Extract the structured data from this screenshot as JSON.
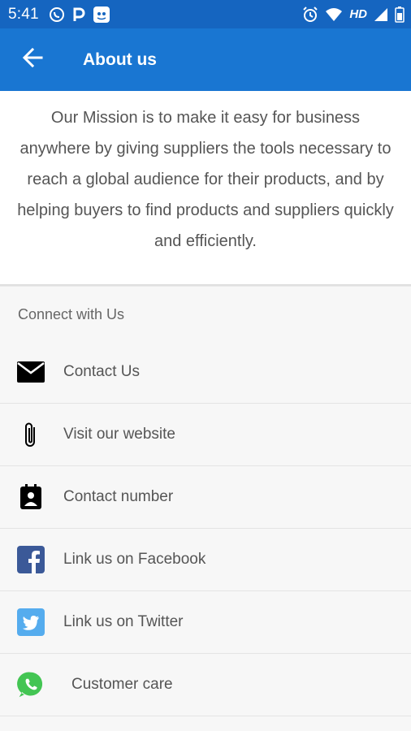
{
  "status_bar": {
    "time": "5:41",
    "left_icons": [
      "whatsapp-icon",
      "p-icon",
      "app-icon"
    ],
    "right_icons": [
      "alarm-icon",
      "wifi-icon",
      "signal-icon",
      "battery-icon"
    ],
    "network": "HD"
  },
  "app_bar": {
    "title": "About us",
    "back_icon": "arrow-back-icon",
    "color": "#1976d2"
  },
  "mission": {
    "text": "Our Mission is to make it easy for business anywhere by giving suppliers the tools necessary to reach a global audience for their products, and by helping buyers to find products and suppliers quickly and efficiently."
  },
  "connect": {
    "header": "Connect with Us",
    "items": [
      {
        "label": "Contact Us",
        "icon": "mail-icon"
      },
      {
        "label": "Visit our website",
        "icon": "paperclip-icon"
      },
      {
        "label": "Contact number",
        "icon": "contact-card-icon"
      },
      {
        "label": "Link us on Facebook",
        "icon": "facebook-icon",
        "color": "#3b5998"
      },
      {
        "label": "Link us on Twitter",
        "icon": "twitter-icon",
        "color": "#55acee"
      },
      {
        "label": "Customer care",
        "icon": "whatsapp-icon",
        "color": "#43c553"
      }
    ]
  }
}
